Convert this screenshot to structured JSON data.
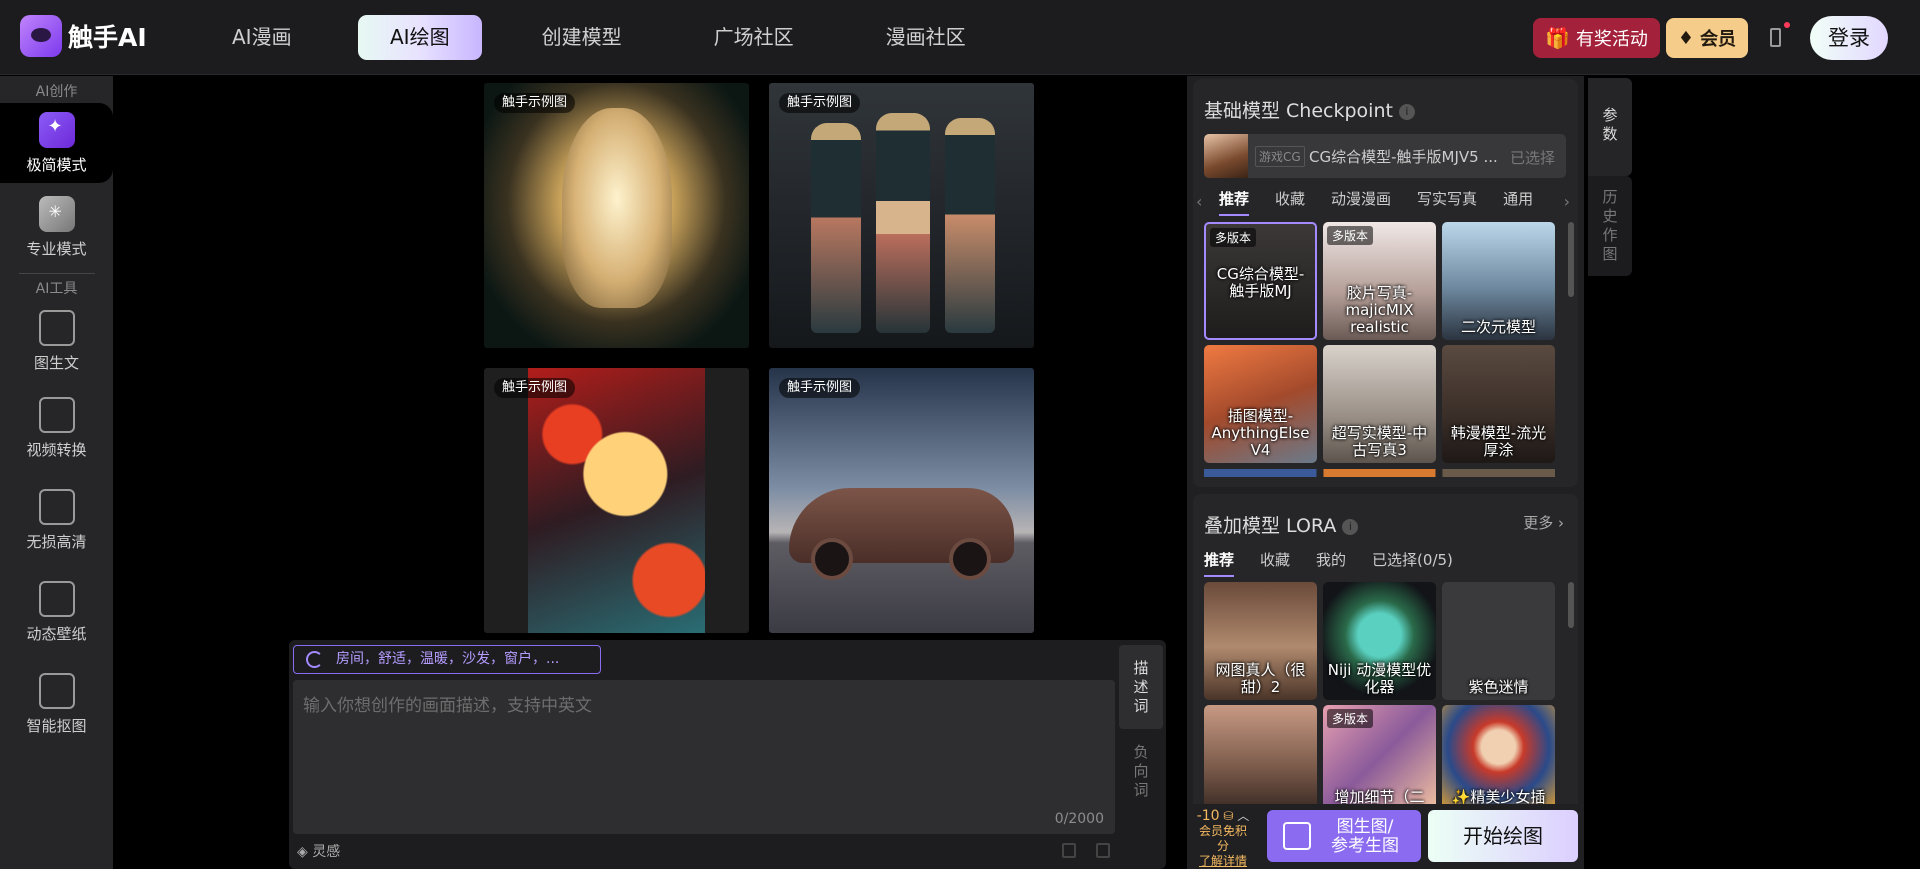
{
  "brand": {
    "name": "触手AI"
  },
  "nav": {
    "tabs": [
      "AI漫画",
      "AI绘图",
      "创建模型",
      "广场社区",
      "漫画社区"
    ]
  },
  "header_right": {
    "promo": "有奖活动",
    "vip": "会员",
    "login": "登录"
  },
  "sidebar": {
    "section1": "AI创作",
    "simple_mode": "极简模式",
    "pro_mode": "专业模式",
    "section2": "AI工具",
    "tools": [
      "图生文",
      "视频转换",
      "无损高清",
      "动态壁纸",
      "智能抠图"
    ]
  },
  "gallery": {
    "tag": "触手示例图"
  },
  "prompt": {
    "chip": "房间，舒适，温暖，沙发，窗户，...",
    "placeholder": "输入你想创作的画面描述，支持中英文",
    "count": "0/2000",
    "tab_desc": "描述词",
    "tab_neg": "负向词",
    "inspiration": "灵感"
  },
  "checkpoint": {
    "title": "基础模型 Checkpoint",
    "selected_tag": "游戏CG",
    "selected_name": "CG综合模型-触手版MJV5 ...",
    "selected_status": "已选择",
    "tabs": [
      "推荐",
      "收藏",
      "动漫漫画",
      "写实写真",
      "通用"
    ],
    "multi_version": "多版本",
    "models": [
      {
        "label": "CG综合模型-触手版MJ",
        "multi": true
      },
      {
        "label": "胶片写真-majicMIX realistic",
        "multi": true
      },
      {
        "label": "二次元模型",
        "multi": false
      },
      {
        "label": "插图模型-AnythingElse V4",
        "multi": false
      },
      {
        "label": "超写实模型-中古写真3",
        "multi": false
      },
      {
        "label": "韩漫模型-流光厚涂",
        "multi": false
      }
    ]
  },
  "lora": {
    "title": "叠加模型 LORA",
    "more": "更多",
    "tabs": [
      "推荐",
      "收藏",
      "我的",
      "已选择(0/5)"
    ],
    "models": [
      {
        "label": "网图真人（很甜）2",
        "multi": false
      },
      {
        "label": "Niji 动漫模型优化器",
        "multi": false
      },
      {
        "label": "紫色迷情",
        "multi": false
      },
      {
        "label": "",
        "multi": false
      },
      {
        "label": "增加细节（二",
        "multi": true
      },
      {
        "label": "✨精美少女插",
        "multi": false
      }
    ]
  },
  "side_tabs": {
    "params": "参数",
    "history": "历史作图"
  },
  "actions": {
    "cost": "-10",
    "free_note": "会员免积分",
    "detail_link": "了解详情",
    "img2img_line1": "图生图/",
    "img2img_line2": "参考生图",
    "start": "开始绘图"
  },
  "colors": {
    "accent": "#a48aff",
    "promo": "#a3213a",
    "vip": "#f5cc8a"
  }
}
